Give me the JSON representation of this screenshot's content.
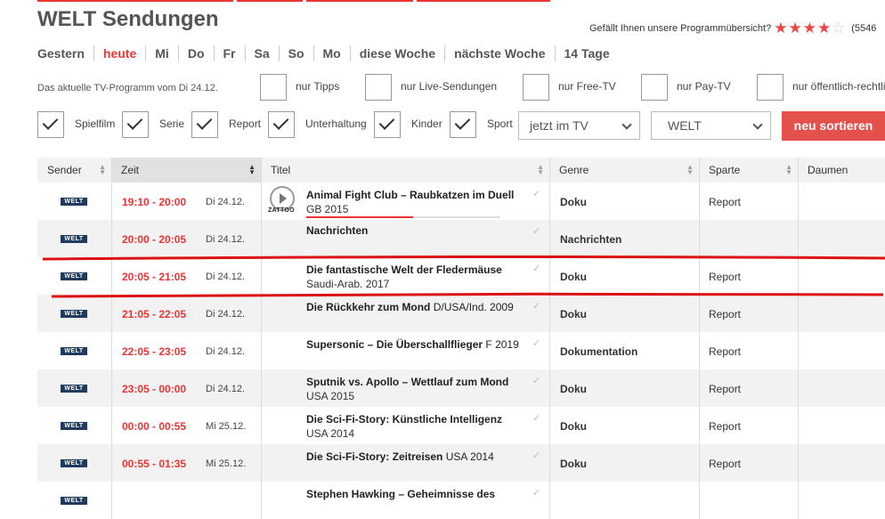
{
  "page": {
    "title": "WELT Sendungen"
  },
  "rating": {
    "question": "Gefällt Ihnen unsere Programmübersicht?",
    "stars_filled": 4,
    "stars_total": 5,
    "count": "(5546"
  },
  "days": [
    "Gestern",
    "heute",
    "Mi",
    "Do",
    "Fr",
    "Sa",
    "So",
    "Mo",
    "diese Woche",
    "nächste Woche",
    "14 Tage"
  ],
  "active_day": "heute",
  "subtitle": "Das aktuelle TV-Programm vom Di 24.12.",
  "filters_top": [
    {
      "label": "nur Tipps",
      "checked": false
    },
    {
      "label": "nur Live-Sendungen",
      "checked": false
    },
    {
      "label": "nur Free-TV",
      "checked": false
    },
    {
      "label": "nur Pay-TV",
      "checked": false
    },
    {
      "label": "nur öffentlich-rechtli",
      "checked": false
    }
  ],
  "filters_genre": [
    {
      "label": "Spielfilm",
      "checked": true
    },
    {
      "label": "Serie",
      "checked": true
    },
    {
      "label": "Report",
      "checked": true
    },
    {
      "label": "Unterhaltung",
      "checked": true
    },
    {
      "label": "Kinder",
      "checked": true
    },
    {
      "label": "Sport",
      "checked": true
    }
  ],
  "select_time": "jetzt im TV",
  "select_channel": "WELT",
  "sort_button": "neu sortieren",
  "columns": [
    "Sender",
    "Zeit",
    "Titel",
    "Genre",
    "Sparte",
    "Daumen"
  ],
  "channel_logo": "WELT",
  "zattoo_label": "ZATTOO",
  "rows": [
    {
      "time": "19:10 - 20:00",
      "date": "Di 24.12.",
      "title": "Animal Fight Club – Raubkatzen im Duell",
      "meta": "GB  2015",
      "genre": "Doku",
      "sparte": "Report",
      "progress": 0.55
    },
    {
      "time": "20:00 - 20:05",
      "date": "Di 24.12.",
      "title": "Nachrichten",
      "meta": "",
      "genre": "Nachrichten",
      "sparte": ""
    },
    {
      "time": "20:05 - 21:05",
      "date": "Di 24.12.",
      "title": "Die fantastische Welt der Fledermäuse",
      "meta": "Saudi-Arab.  2017",
      "genre": "Doku",
      "sparte": "Report"
    },
    {
      "time": "21:05 - 22:05",
      "date": "Di 24.12.",
      "title": "Die Rückkehr zum Mond",
      "inline": "D/USA/Ind.  2009",
      "genre": "Doku",
      "sparte": "Report"
    },
    {
      "time": "22:05 - 23:05",
      "date": "Di 24.12.",
      "title": "Supersonic – Die Überschallflieger",
      "inline": "F  2019",
      "genre": "Dokumentation",
      "sparte": "Report"
    },
    {
      "time": "23:05 - 00:00",
      "date": "Di 24.12.",
      "title": "Sputnik vs. Apollo – Wettlauf zum Mond",
      "meta": "USA  2015",
      "genre": "Doku",
      "sparte": "Report"
    },
    {
      "time": "00:00 - 00:55",
      "date": "Mi 25.12.",
      "title": "Die Sci-Fi-Story: Künstliche Intelligenz",
      "meta": "USA  2014",
      "genre": "Doku",
      "sparte": "Report"
    },
    {
      "time": "00:55 - 01:35",
      "date": "Mi 25.12.",
      "title": "Die Sci-Fi-Story: Zeitreisen",
      "inline": "USA  2014",
      "genre": "Doku",
      "sparte": "Report"
    },
    {
      "time": "",
      "date": "",
      "title": "Stephen Hawking – Geheimnisse des",
      "meta": "",
      "genre": "",
      "sparte": ""
    }
  ],
  "colors": {
    "accent": "#e33333",
    "button": "#e4514d",
    "logo": "#1e3a5c"
  }
}
